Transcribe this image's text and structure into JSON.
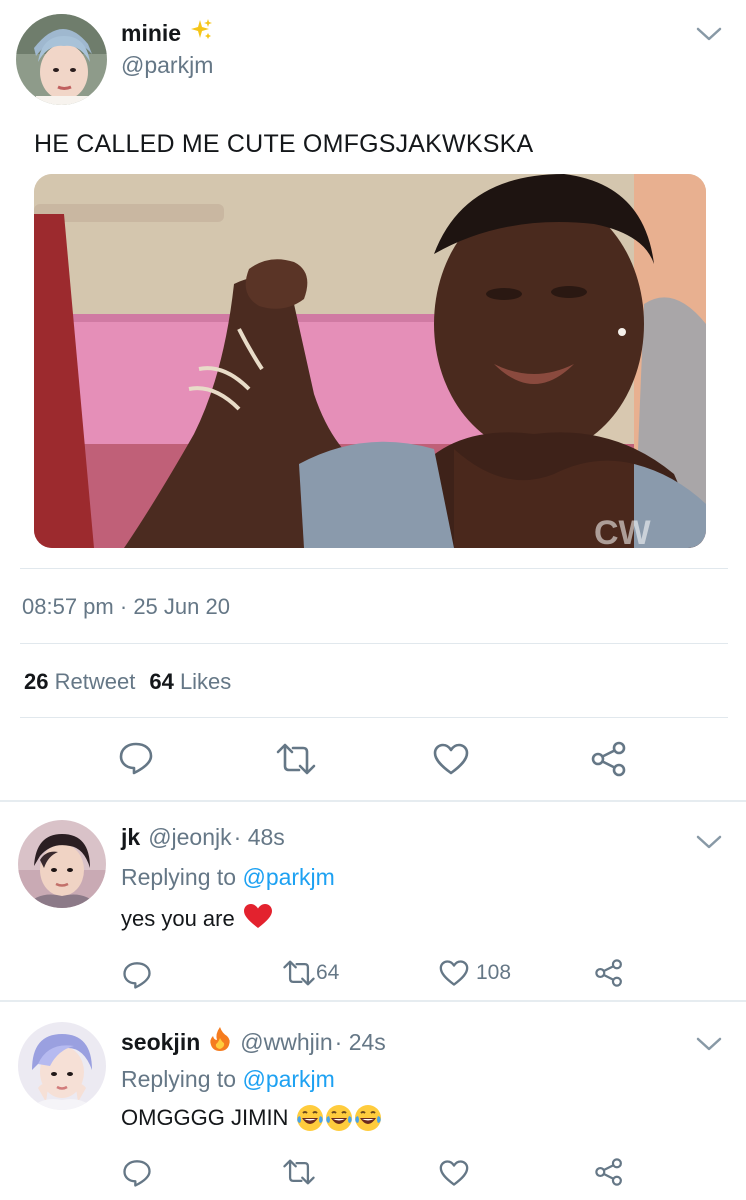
{
  "tweet": {
    "name": "minie",
    "handle": "@parkjm",
    "text": "HE CALLED ME CUTE OMFGSJAKWKSKA",
    "time": "08:57 pm",
    "separator": "·",
    "date": "25 Jun 20",
    "retweets_count": "26",
    "retweets_label": "Retweet",
    "likes_count": "64",
    "likes_label": "Likes"
  },
  "replies": [
    {
      "name": "jk",
      "handle": "@jeonjk",
      "time": "· 48s",
      "replying_label": "Replying to",
      "replying_to": "@parkjm",
      "text": "yes you are",
      "retweets": "64",
      "likes": "108"
    },
    {
      "name": "seokjin",
      "handle": "@wwhjin",
      "time": "· 24s",
      "replying_label": "Replying to",
      "replying_to": "@parkjm",
      "text": "OMGGGG JIMIN",
      "retweets": "",
      "likes": ""
    }
  ],
  "colors": {
    "accent": "#1da1f2",
    "secondary_text": "#657786",
    "like_heart": "#e0245e"
  }
}
